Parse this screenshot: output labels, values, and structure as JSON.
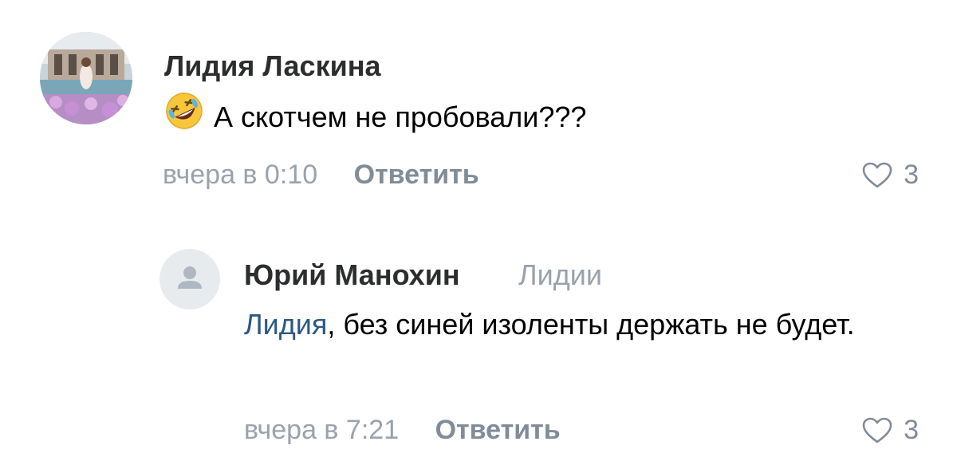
{
  "comments": [
    {
      "author": "Лидия Ласкина",
      "text": "А скотчем не пробовали???",
      "emoji": "rolling-on-floor-laughing-emoji",
      "time": "вчера в 0:10",
      "reply_label": "Ответить",
      "likes": "3"
    },
    {
      "author": "Юрий Манохин",
      "reply_to": "Лидии",
      "mention": "Лидия",
      "text": ", без синей изоленты держать не будет.",
      "time": "вчера в 7:21",
      "reply_label": "Ответить",
      "likes": "3"
    }
  ],
  "colors": {
    "mention": "#2a5885",
    "secondary_text": "#99a2ad",
    "author_text": "#2c2d2e"
  }
}
